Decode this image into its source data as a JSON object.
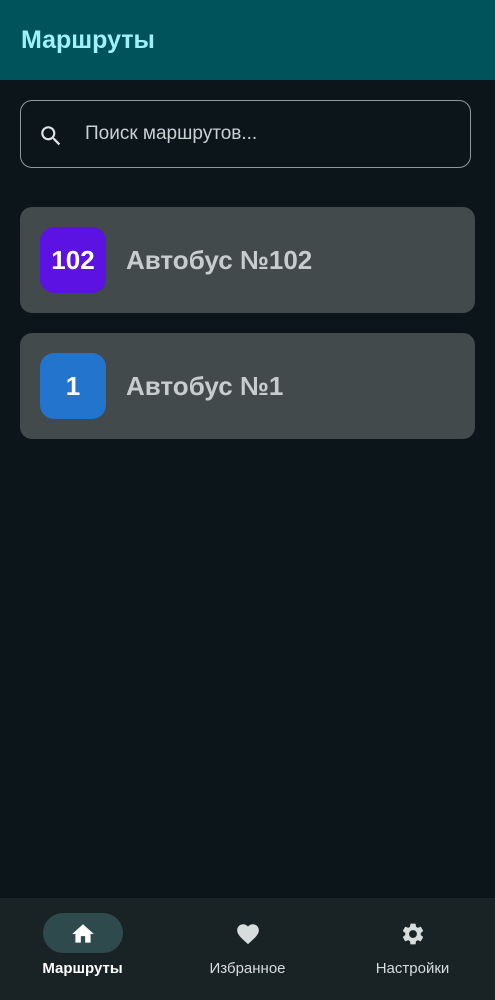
{
  "header": {
    "title": "Маршруты",
    "background": "#00535b",
    "title_color": "#9ff1f7"
  },
  "search": {
    "icon": "search-icon",
    "placeholder": "Поиск маршрутов...",
    "value": ""
  },
  "routes": [
    {
      "number": "102",
      "title": "Автобус №102",
      "badge_color": "#5b12e2"
    },
    {
      "number": "1",
      "title": "Автобус №1",
      "badge_color": "#2274cc"
    }
  ],
  "bottom_nav": {
    "items": [
      {
        "label": "Маршруты",
        "icon": "home-icon",
        "active": true
      },
      {
        "label": "Избранное",
        "icon": "heart-icon",
        "active": false
      },
      {
        "label": "Настройки",
        "icon": "gear-icon",
        "active": false
      }
    ]
  },
  "colors": {
    "background": "#0c1519",
    "card": "#434a4c",
    "nav_background": "#192225",
    "nav_active_pill": "#2f4a4d"
  }
}
